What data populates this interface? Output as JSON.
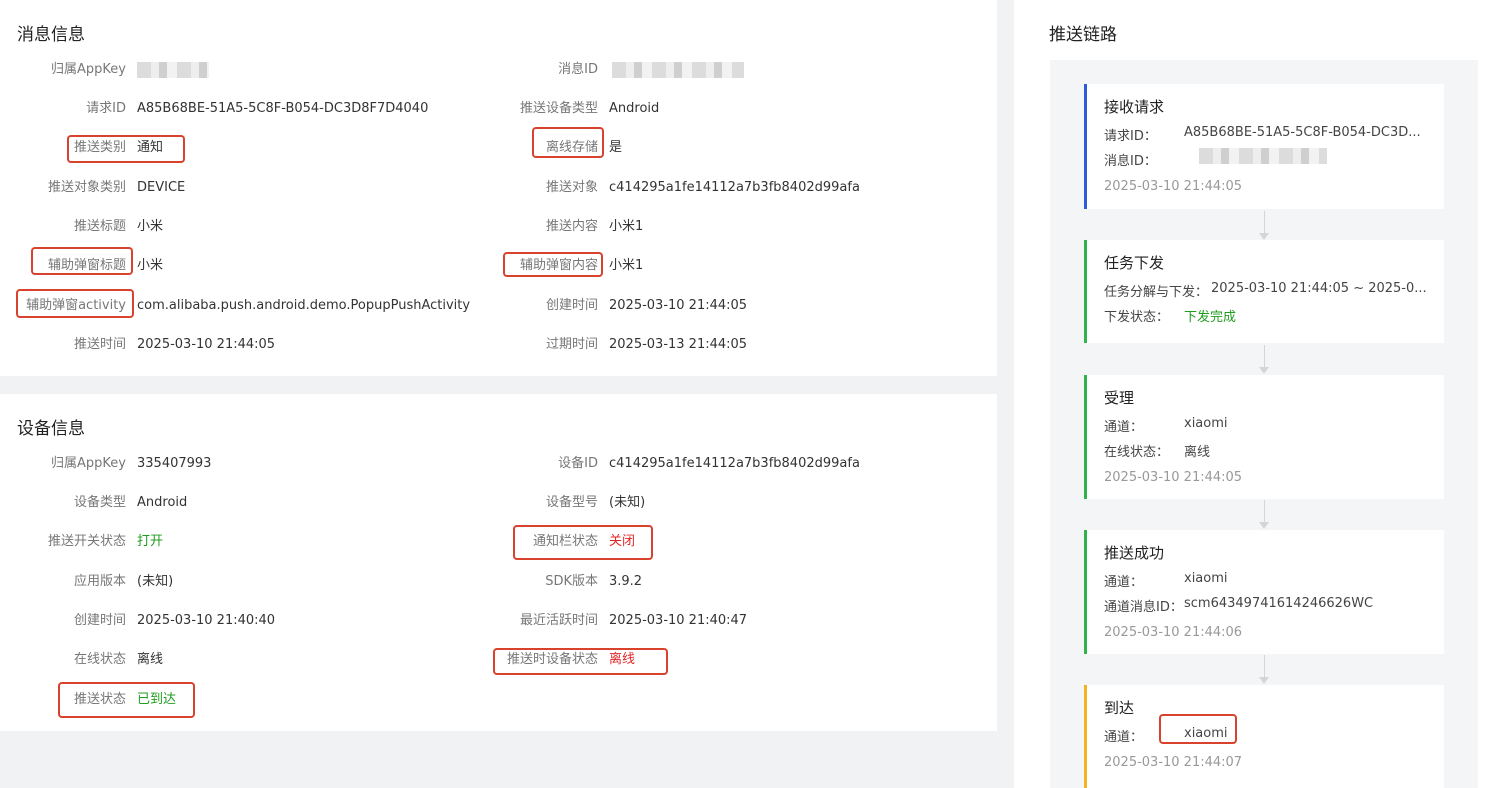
{
  "message_info": {
    "title": "消息信息",
    "app_key": {
      "label": "归属AppKey"
    },
    "message_id": {
      "label": "消息ID"
    },
    "request_id": {
      "label": "请求ID",
      "value": "A85B68BE-51A5-5C8F-B054-DC3D8F7D4040"
    },
    "device_type": {
      "label": "推送设备类型",
      "value": "Android"
    },
    "push_type": {
      "label": "推送类别",
      "value": "通知"
    },
    "offline_store": {
      "label": "离线存储",
      "value": "是"
    },
    "target_type": {
      "label": "推送对象类别",
      "value": "DEVICE"
    },
    "target": {
      "label": "推送对象",
      "value": "c414295a1fe14112a7b3fb8402d99afa"
    },
    "push_title": {
      "label": "推送标题",
      "value": "小米"
    },
    "push_content": {
      "label": "推送内容",
      "value": "小米1"
    },
    "popup_title": {
      "label": "辅助弹窗标题",
      "value": "小米"
    },
    "popup_content": {
      "label": "辅助弹窗内容",
      "value": "小米1"
    },
    "popup_activity": {
      "label": "辅助弹窗activity",
      "value": "com.alibaba.push.android.demo.PopupPushActivity"
    },
    "created_at": {
      "label": "创建时间",
      "value": "2025-03-10 21:44:05"
    },
    "push_time": {
      "label": "推送时间",
      "value": "2025-03-10 21:44:05"
    },
    "expire_time": {
      "label": "过期时间",
      "value": "2025-03-13 21:44:05"
    }
  },
  "device_info": {
    "title": "设备信息",
    "app_key": {
      "label": "归属AppKey",
      "value": "335407993"
    },
    "device_id": {
      "label": "设备ID",
      "value": "c414295a1fe14112a7b3fb8402d99afa"
    },
    "device_type": {
      "label": "设备类型",
      "value": "Android"
    },
    "device_model": {
      "label": "设备型号",
      "value": "(未知)"
    },
    "push_switch": {
      "label": "推送开关状态",
      "value": "打开"
    },
    "notify_bar": {
      "label": "通知栏状态",
      "value": "关闭"
    },
    "app_version": {
      "label": "应用版本",
      "value": "(未知)"
    },
    "sdk_version": {
      "label": "SDK版本",
      "value": "3.9.2"
    },
    "created_at": {
      "label": "创建时间",
      "value": "2025-03-10 21:40:40"
    },
    "last_active": {
      "label": "最近活跃时间",
      "value": "2025-03-10 21:40:47"
    },
    "online_status": {
      "label": "在线状态",
      "value": "离线"
    },
    "push_device_status": {
      "label": "推送时设备状态",
      "value": "离线"
    },
    "push_status": {
      "label": "推送状态",
      "value": "已到达"
    }
  },
  "push_chain": {
    "title": "推送链路",
    "colors": {
      "blue": "#2f5bd8",
      "green": "#2fb34a",
      "yellow": "#f5b324"
    },
    "steps": [
      {
        "title": "接收请求",
        "lines": [
          {
            "k": "请求ID：",
            "v": "A85B68BE-51A5-5C8F-B054-DC3D..."
          },
          {
            "k": "消息ID："
          }
        ],
        "time": "2025-03-10 21:44:05"
      },
      {
        "title": "任务下发",
        "lines": [
          {
            "k": "任务分解与下发：",
            "v": "2025-03-10 21:44:05 ~ 2025-0..."
          },
          {
            "k": "下发状态：",
            "v": "下发完成"
          }
        ]
      },
      {
        "title": "受理",
        "lines": [
          {
            "k": "通道：",
            "v": "xiaomi"
          },
          {
            "k": "在线状态：",
            "v": "离线"
          }
        ],
        "time": "2025-03-10 21:44:05"
      },
      {
        "title": "推送成功",
        "lines": [
          {
            "k": "通道：",
            "v": "xiaomi"
          },
          {
            "k": "通道消息ID：",
            "v": "scm64349741614246626WC"
          }
        ],
        "time": "2025-03-10 21:44:06"
      },
      {
        "title": "到达",
        "lines": [
          {
            "k": "通道：",
            "v": "xiaomi"
          }
        ],
        "time": "2025-03-10 21:44:07"
      }
    ]
  }
}
